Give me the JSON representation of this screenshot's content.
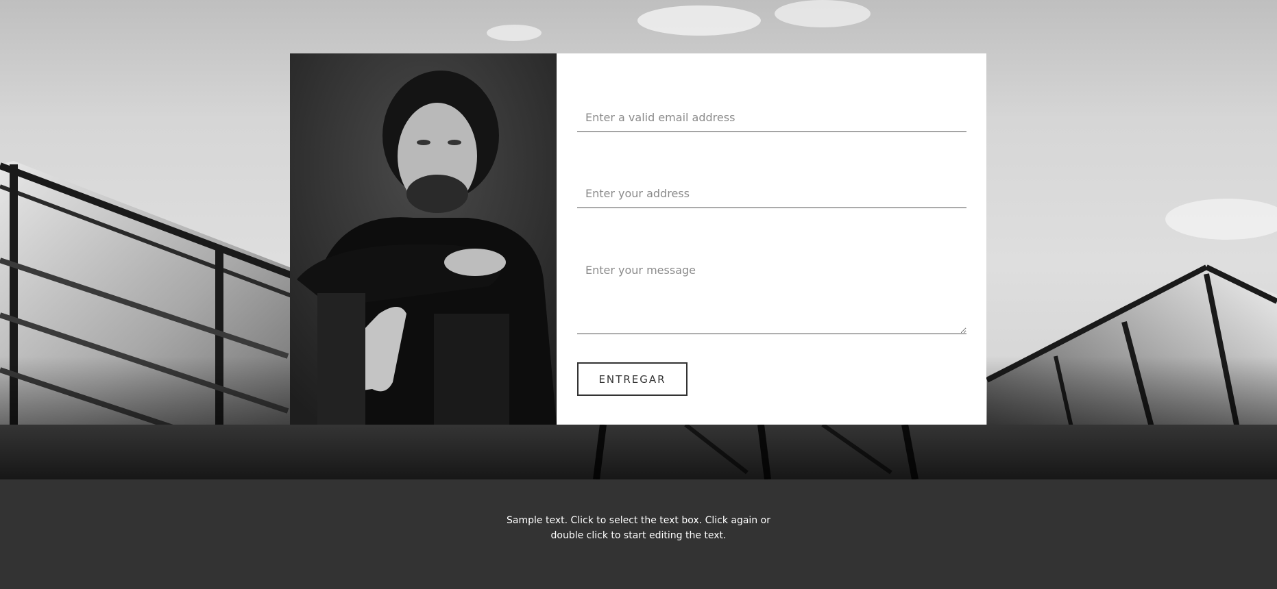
{
  "form": {
    "email_placeholder": "Enter a valid email address",
    "address_placeholder": "Enter your address",
    "message_placeholder": "Enter your message",
    "submit_label": "ENTREGAR"
  },
  "footer": {
    "text": "Sample text. Click to select the text box. Click again or double click to start editing the text."
  },
  "colors": {
    "footer_background": "#333333",
    "form_background": "#ffffff",
    "button_border": "#333333",
    "field_underline": "#4a4a4a"
  },
  "images": {
    "background": "black-and-white-glass-roof",
    "portrait": "black-and-white-portrait"
  }
}
